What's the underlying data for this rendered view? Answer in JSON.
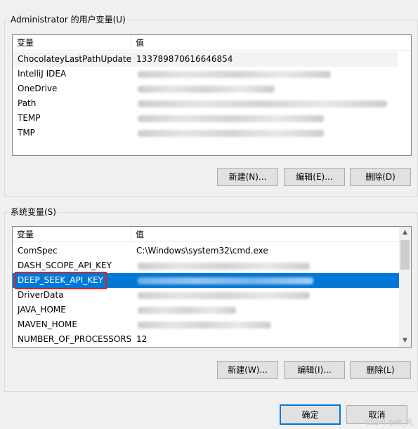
{
  "user_vars": {
    "group_label": "Administrator 的用户变量(U)",
    "header": {
      "name": "变量",
      "value": "值"
    },
    "rows": [
      {
        "name": "ChocolateyLastPathUpdate",
        "value": "133789870616646854"
      },
      {
        "name": "IntelliJ IDEA",
        "value": ""
      },
      {
        "name": "OneDrive",
        "value": ""
      },
      {
        "name": "Path",
        "value": ""
      },
      {
        "name": "TEMP",
        "value": ""
      },
      {
        "name": "TMP",
        "value": ""
      }
    ],
    "buttons": {
      "new": "新建(N)...",
      "edit": "编辑(E)...",
      "delete": "删除(D)"
    }
  },
  "system_vars": {
    "group_label": "系统变量(S)",
    "header": {
      "name": "变量",
      "value": "值"
    },
    "rows": [
      {
        "name": "ComSpec",
        "value": "C:\\Windows\\system32\\cmd.exe"
      },
      {
        "name": "DASH_SCOPE_API_KEY",
        "value": ""
      },
      {
        "name": "DEEP_SEEK_API_KEY",
        "value": ""
      },
      {
        "name": "DriverData",
        "value": ""
      },
      {
        "name": "JAVA_HOME",
        "value": ""
      },
      {
        "name": "MAVEN_HOME",
        "value": ""
      },
      {
        "name": "NUMBER_OF_PROCESSORS",
        "value": "12"
      }
    ],
    "buttons": {
      "new": "新建(W)...",
      "edit": "编辑(I)...",
      "delete": "删除(L)"
    }
  },
  "dialog_buttons": {
    "ok": "确定",
    "cancel": "取消"
  },
  "watermark": "CSDN @霜_风",
  "colors": {
    "selection": "#0078d7",
    "highlight_box": "#e02020"
  },
  "icons": {
    "scroll_up": "▲",
    "scroll_down": "▼"
  }
}
